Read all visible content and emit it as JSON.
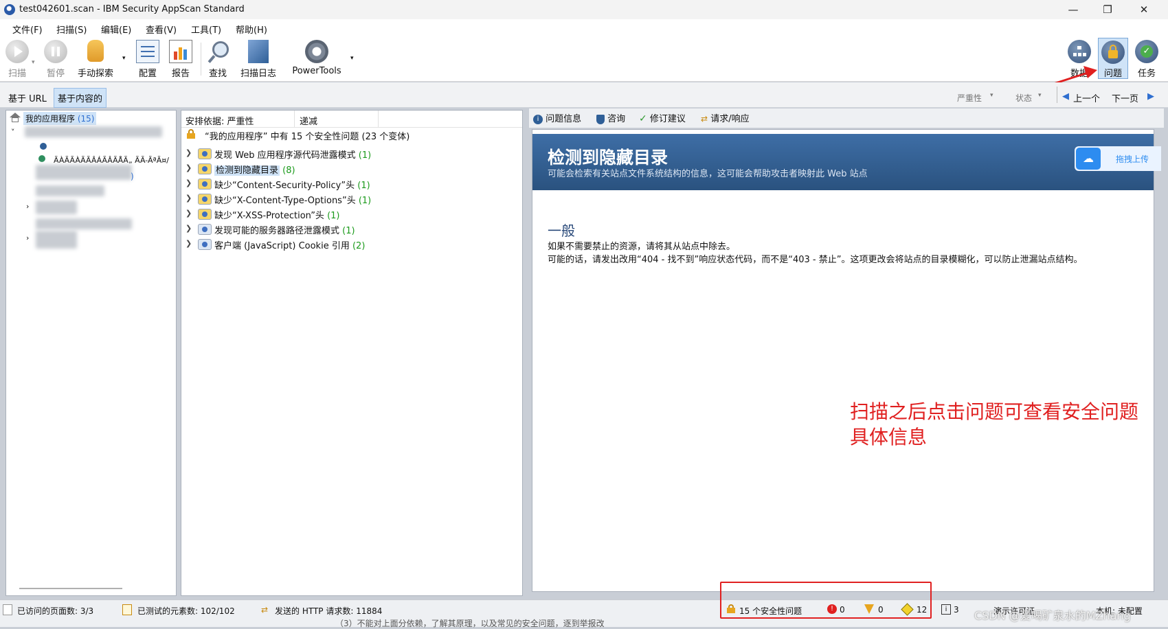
{
  "window": {
    "title": "test042601.scan - IBM Security AppScan Standard",
    "controls": [
      "—",
      "❐",
      "✕"
    ]
  },
  "menu": [
    "文件(F)",
    "扫描(S)",
    "编辑(E)",
    "查看(V)",
    "工具(T)",
    "帮助(H)"
  ],
  "toolbar": {
    "scan": "扫描",
    "pause": "暂停",
    "manual_explore": "手动探索",
    "config": "配置",
    "report": "报告",
    "find": "查找",
    "scan_log": "扫描日志",
    "powertools": "PowerTools",
    "data": "数据",
    "issues": "问题",
    "tasks": "任务"
  },
  "viewbar": {
    "by_url": "基于 URL",
    "by_content": "基于内容的",
    "severity": "严重性",
    "state": "状态",
    "prev": "上一个",
    "next": "下一页"
  },
  "tree": {
    "root_label": "我的应用程序",
    "root_count": "(15)",
    "garbled": "ÃÀÃÃÀÃÃÂÁÃÂÃÅÃ„ ÃÃ-ÃªÃ¤/"
  },
  "issues_panel": {
    "header_sort": "安排依据: 严重性",
    "header_dec": "递减",
    "summary": "“我的应用程序” 中有 15 个安全性问题 (23 个变体)",
    "items": [
      {
        "label": "发现 Web 应用程序源代码泄露模式",
        "count": "(1)"
      },
      {
        "label": "检测到隐藏目录",
        "count": "(8)"
      },
      {
        "label": "缺少“Content-Security-Policy”头",
        "count": "(1)"
      },
      {
        "label": "缺少“X-Content-Type-Options”头",
        "count": "(1)"
      },
      {
        "label": "缺少“X-XSS-Protection”头",
        "count": "(1)"
      },
      {
        "label": "发现可能的服务器路径泄露模式",
        "count": "(1)"
      },
      {
        "label": "客户端 (JavaScript) Cookie 引用",
        "count": "(2)"
      }
    ]
  },
  "detail": {
    "tabs": [
      "问题信息",
      "咨询",
      "修订建议",
      "请求/响应"
    ],
    "banner_title": "检测到隐藏目录",
    "banner_subtitle": "可能会检索有关站点文件系统结构的信息，这可能会帮助攻击者映射此 Web 站点",
    "upload": "拖拽上传",
    "section": "一般",
    "line1": "如果不需要禁止的资源，请将其从站点中除去。",
    "line2": "可能的话，请发出改用“404 - 找不到”响应状态代码，而不是“403 - 禁止”。这项更改会将站点的目录模糊化，可以防止泄漏站点结构。",
    "annotation_line1": "扫描之后点击问题可查看安全问题",
    "annotation_line2": "具体信息"
  },
  "status": {
    "pages_visited": "已访问的页面数: 3/3",
    "elements_tested": "已测试的元素数: 102/102",
    "http_requests": "发送的 HTTP 请求数: 11884",
    "issues": "15 个安全性问题",
    "high": "0",
    "medium": "0",
    "low": "12",
    "info": "3",
    "tail": "演示许可证",
    "tail2": "本机: 未配置",
    "watermark": "CSDN @爱喝矿泉水的MZhang",
    "behind_text": "（3）不能对上面分依赖，了解其原理，以及常见的安全问题，逐到举报改"
  },
  "colors": {
    "accent": "#2f5f97",
    "annotation": "#e02020",
    "highlight": "#cfe3f7"
  }
}
